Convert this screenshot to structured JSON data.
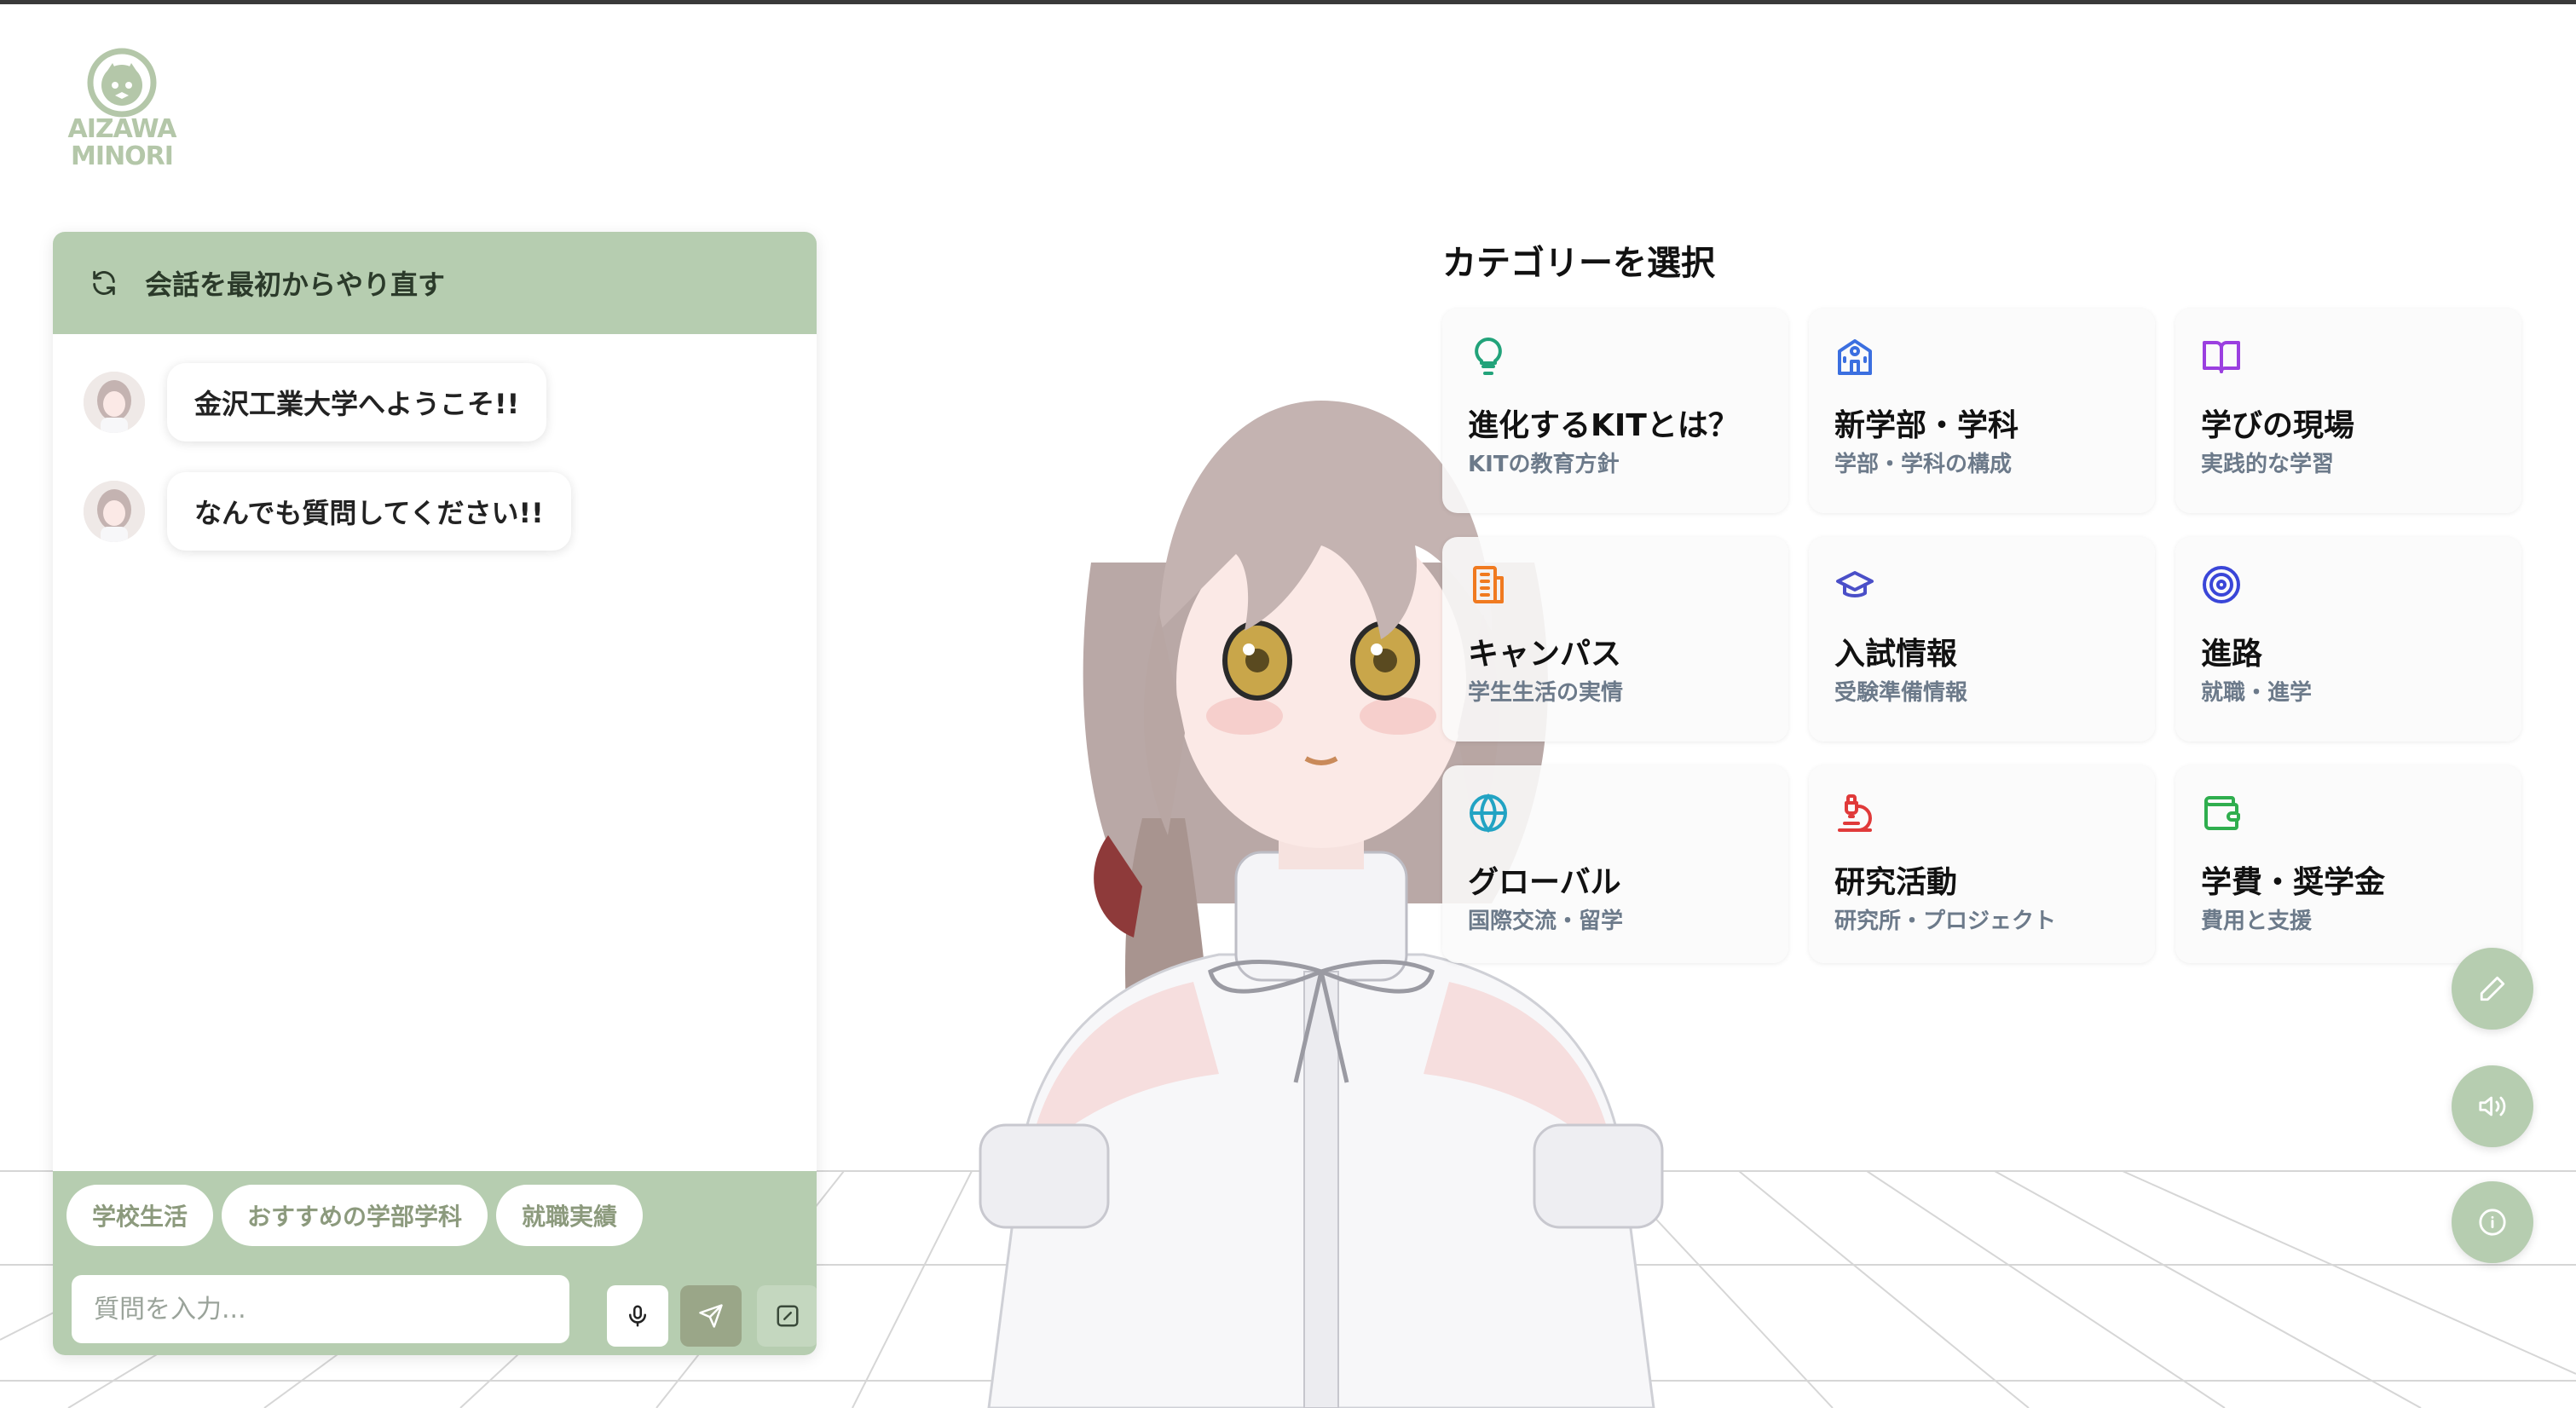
{
  "logo": {
    "line1": "AIZAWA",
    "line2": "MINORI"
  },
  "chat": {
    "header_title": "会話を最初からやり直す",
    "messages": [
      {
        "text": "金沢工業大学へようこそ!!"
      },
      {
        "text": "なんでも質問してください!!"
      }
    ],
    "chips": [
      "学校生活",
      "おすすめの学部学科",
      "就職実績"
    ],
    "input_placeholder": "質問を入力..."
  },
  "categories": {
    "heading": "カテゴリーを選択",
    "items": [
      {
        "title": "進化するKITとは？",
        "subtitle": "KITの教育方針",
        "icon": "lightbulb-icon",
        "color": "#22a37a"
      },
      {
        "title": "新学部・学科",
        "subtitle": "学部・学科の構成",
        "icon": "school-building-icon",
        "color": "#3b6fe0"
      },
      {
        "title": "学びの現場",
        "subtitle": "実践的な学習",
        "icon": "open-book-icon",
        "color": "#9b3fe0"
      },
      {
        "title": "キャンパス",
        "subtitle": "学生生活の実情",
        "icon": "building-icon",
        "color": "#f07a20"
      },
      {
        "title": "入試情報",
        "subtitle": "受験準備情報",
        "icon": "graduation-cap-icon",
        "color": "#4a4fc8"
      },
      {
        "title": "進路",
        "subtitle": "就職・進学",
        "icon": "target-icon",
        "color": "#3a46d8"
      },
      {
        "title": "グローバル",
        "subtitle": "国際交流・留学",
        "icon": "globe-icon",
        "color": "#22a3c3"
      },
      {
        "title": "研究活動",
        "subtitle": "研究所・プロジェクト",
        "icon": "microscope-icon",
        "color": "#e03a3a"
      },
      {
        "title": "学費・奨学金",
        "subtitle": "費用と支援",
        "icon": "wallet-icon",
        "color": "#2fae4e"
      }
    ]
  },
  "side_buttons": [
    "pen-icon",
    "speaker-icon",
    "info-icon"
  ],
  "colors": {
    "accent": "#b6cdb0",
    "chip_text": "#8c9a7d"
  }
}
